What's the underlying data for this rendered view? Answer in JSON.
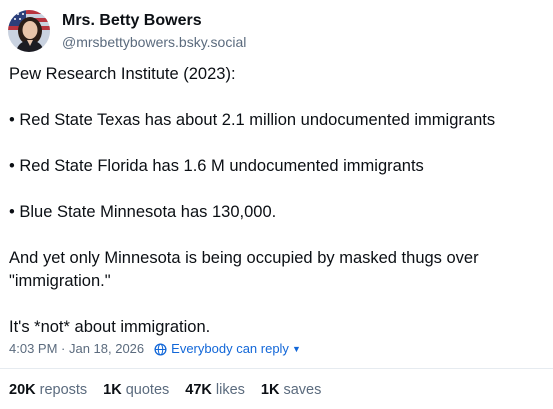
{
  "author": {
    "display_name": "Mrs. Betty Bowers",
    "handle": "@mrsbettybowers.bsky.social"
  },
  "post": {
    "paragraphs": [
      "Pew Research Institute (2023):",
      "• Red State Texas has about 2.1 million undocumented immigrants",
      "• Red State Florida has 1.6 M undocumented immigrants",
      "• Blue State Minnesota has 130,000.",
      "And yet only Minnesota is being occupied by masked thugs over \"immigration.\"",
      "It's *not* about immigration."
    ],
    "timestamp": "4:03 PM · Jan 18, 2026",
    "reply_setting": "Everybody can reply"
  },
  "stats": {
    "reposts": {
      "count": "20K",
      "label": "reposts"
    },
    "quotes": {
      "count": "1K",
      "label": "quotes"
    },
    "likes": {
      "count": "47K",
      "label": "likes"
    },
    "saves": {
      "count": "1K",
      "label": "saves"
    }
  },
  "colors": {
    "text": "#0b0f14",
    "muted": "#5b6b7e",
    "accent": "#1267d8",
    "divider": "#e6ebf0"
  },
  "icons": {
    "reply_setting": "globe-icon",
    "dropdown": "chevron-down-icon"
  }
}
